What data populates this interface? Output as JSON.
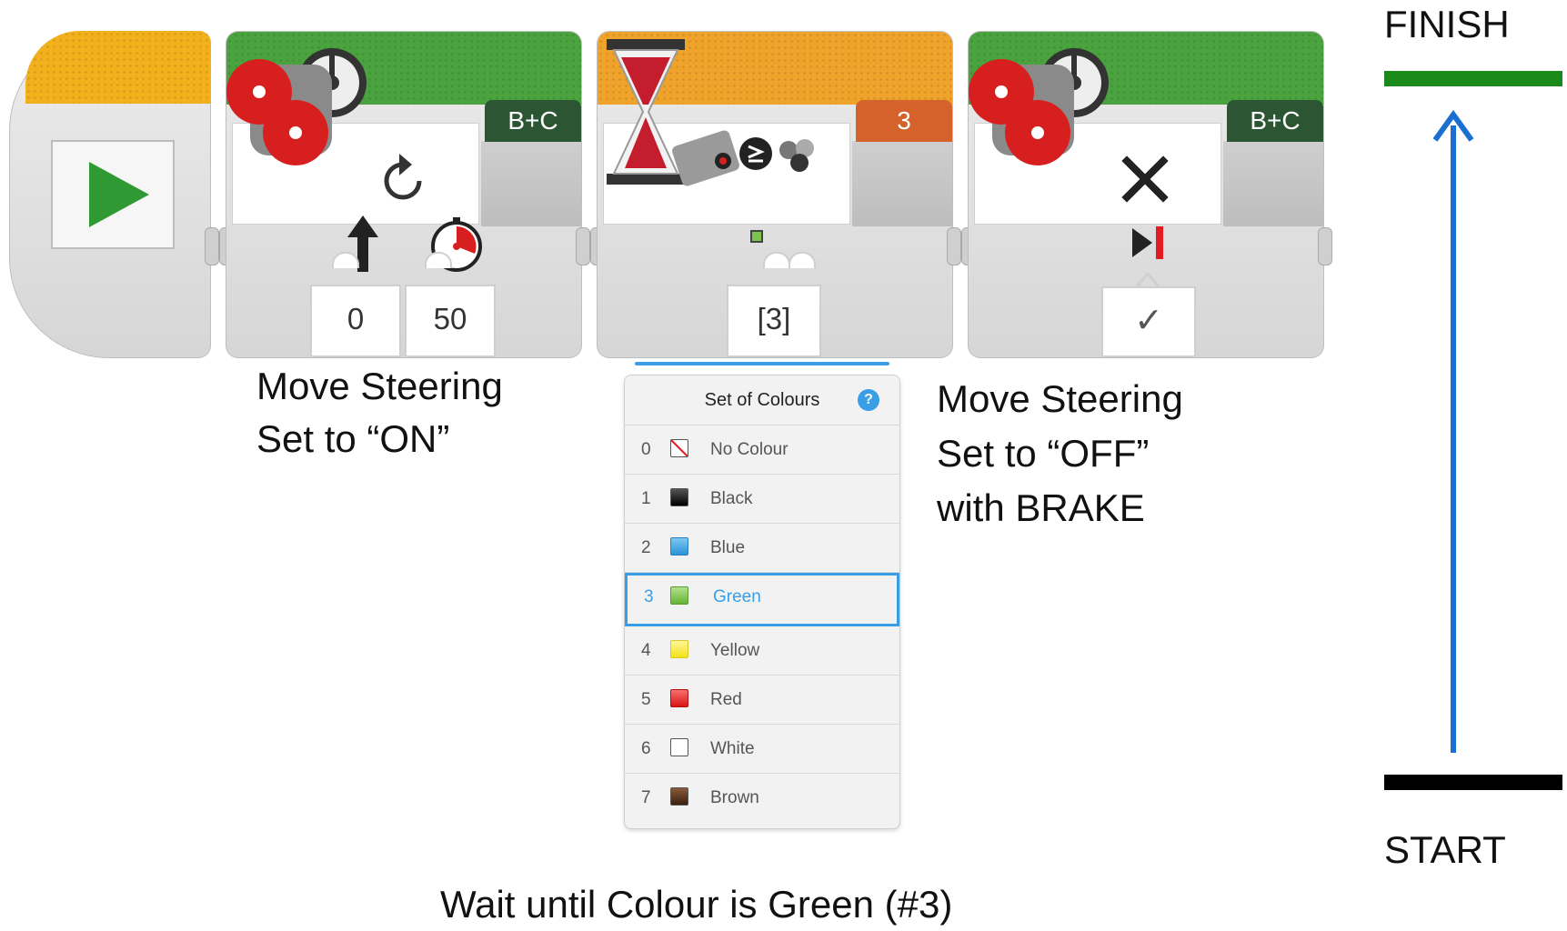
{
  "blocks": {
    "move1": {
      "port": "B+C",
      "direction_value": "0",
      "power_value": "50"
    },
    "wait": {
      "port": "3",
      "colors_value": "[3]"
    },
    "move2": {
      "port": "B+C",
      "brake_value": "✓"
    }
  },
  "palette": {
    "title": "Set of Colours",
    "help": "?",
    "items": [
      {
        "index": "0",
        "name": "No Colour",
        "color": "#ffffff"
      },
      {
        "index": "1",
        "name": "Black",
        "color": "#111111"
      },
      {
        "index": "2",
        "name": "Blue",
        "color": "#3aa9e8"
      },
      {
        "index": "3",
        "name": "Green",
        "color": "#7cc24b"
      },
      {
        "index": "4",
        "name": "Yellow",
        "color": "#f7ea2a"
      },
      {
        "index": "5",
        "name": "Red",
        "color": "#e8242a"
      },
      {
        "index": "6",
        "name": "White",
        "color": "#ffffff"
      },
      {
        "index": "7",
        "name": "Brown",
        "color": "#5a3420"
      }
    ]
  },
  "annotations": {
    "move_on_line1": "Move Steering",
    "move_on_line2": "Set to “ON”",
    "move_off_line1": "Move Steering",
    "move_off_line2": "Set to “OFF”",
    "move_off_line3": "with BRAKE",
    "wait_caption": "Wait until Colour is Green (#3)",
    "finish": "FINISH",
    "start": "START"
  },
  "colors": {
    "finish_line": "#1a8a1a",
    "start_line": "#000000",
    "arrow": "#1a6fd0"
  }
}
